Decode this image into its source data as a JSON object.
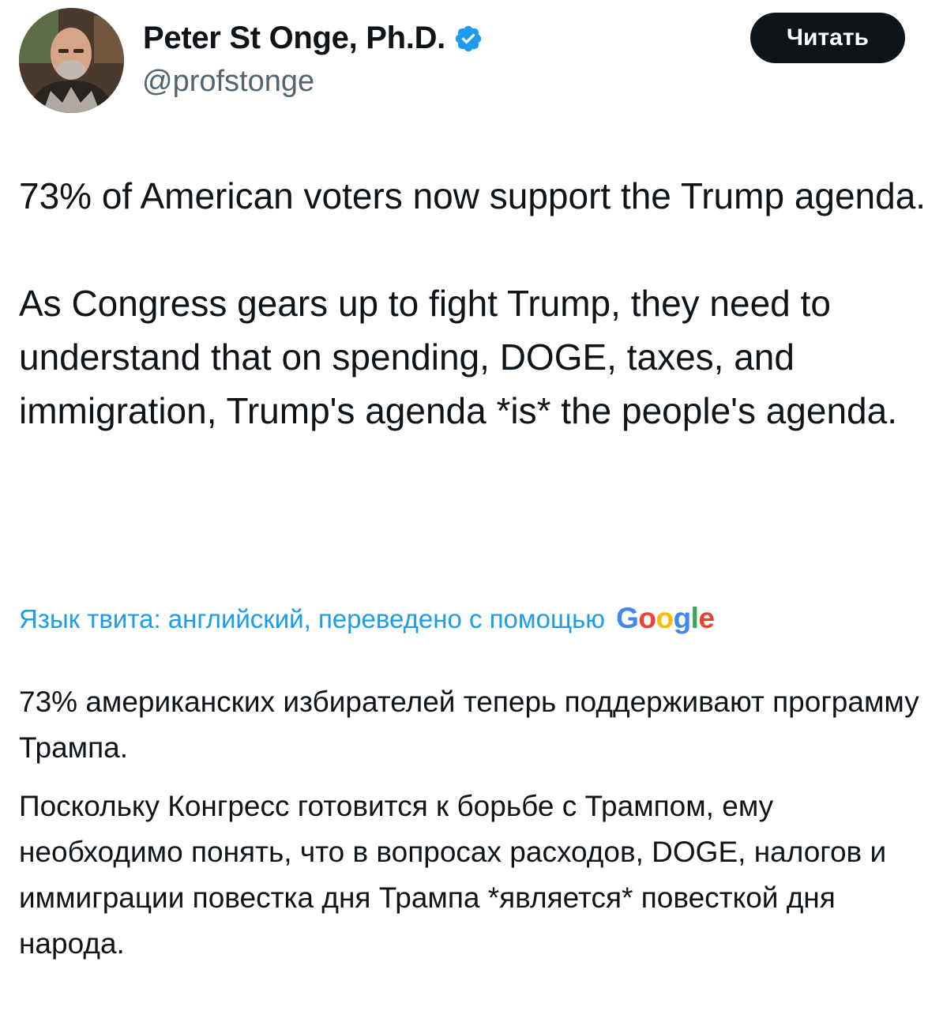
{
  "author": {
    "display_name": "Peter St Onge, Ph.D.",
    "handle": "@profstonge",
    "verified_icon": "verified-badge-icon"
  },
  "follow_button": {
    "label": "Читать"
  },
  "tweet": {
    "paragraph_1": "73% of American voters now support the Trump agenda.",
    "paragraph_2": "As Congress gears up to fight Trump, they need to understand that on spending, DOGE, taxes, and immigration, Trump's agenda *is* the people's agenda."
  },
  "translation": {
    "note": "Язык твита: английский, переведено с помощью",
    "brand": "Google",
    "paragraph_1": "73% американских избирателей теперь поддерживают программу Трампа.",
    "paragraph_2": "Поскольку Конгресс готовится к борьбе с Трампом, ему необходимо понять, что в вопросах расходов, DOGE, налогов и иммиграции повестка дня Трампа *является* повесткой дня народа."
  },
  "colors": {
    "link_blue": "#1d9bf0",
    "text": "#0f1419",
    "muted": "#536471",
    "button_bg": "#0f1419"
  }
}
